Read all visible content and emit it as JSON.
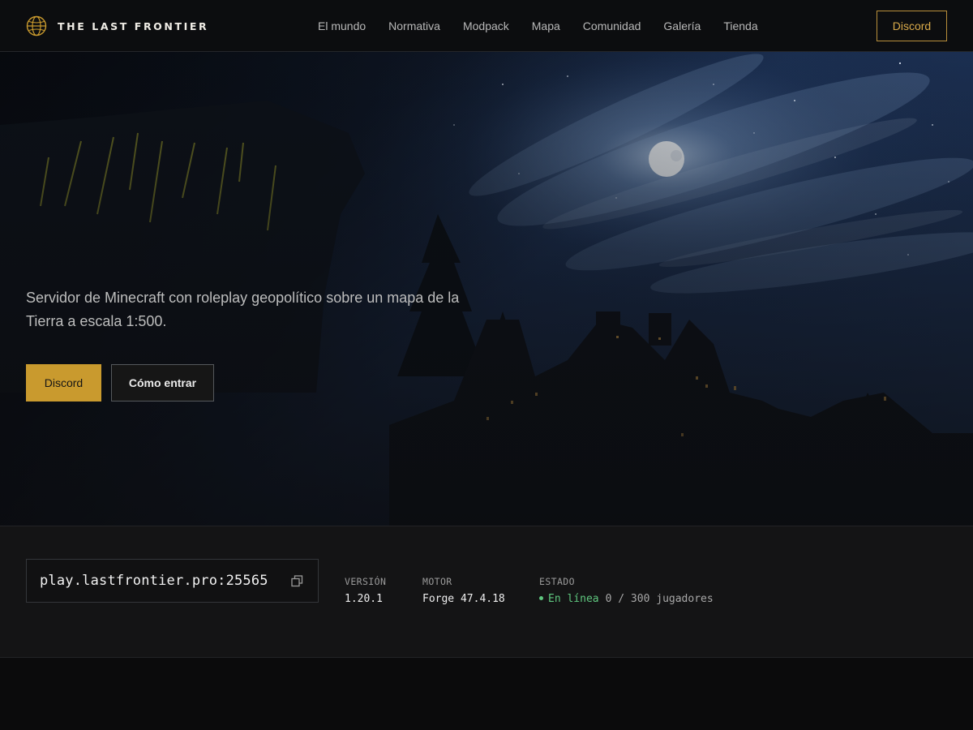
{
  "brand": {
    "name": "THE LAST FRONTIER",
    "logo_icon": "globe-icon",
    "accent": "#c99a2e"
  },
  "nav": {
    "items": [
      {
        "label": "El mundo"
      },
      {
        "label": "Normativa"
      },
      {
        "label": "Modpack"
      },
      {
        "label": "Mapa"
      },
      {
        "label": "Comunidad"
      },
      {
        "label": "Galería"
      },
      {
        "label": "Tienda"
      }
    ],
    "discord_label": "Discord"
  },
  "hero": {
    "description": "Servidor de Minecraft con roleplay geopolítico sobre un mapa de la Tierra a escala 1:500.",
    "primary_button": "Discord",
    "secondary_button": "Cómo entrar"
  },
  "server": {
    "address": "play.lastfrontier.pro:25565",
    "copy_icon": "copy-icon",
    "version": {
      "label": "VERSIÓN",
      "value": "1.20.1"
    },
    "engine": {
      "label": "MOTOR",
      "value": "Forge 47.4.18"
    },
    "status": {
      "label": "ESTADO",
      "state": "En línea",
      "players": "0 / 300 jugadores",
      "color": "#5fc77f"
    }
  }
}
